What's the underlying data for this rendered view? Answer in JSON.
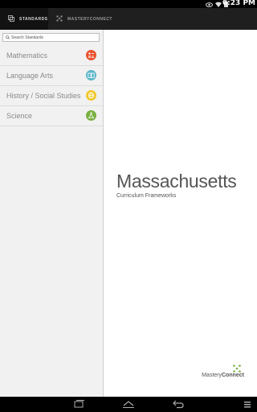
{
  "status": {
    "time": "6:23 PM",
    "icons": [
      "eye-icon",
      "wifi-icon",
      "battery-icon"
    ]
  },
  "tabs": [
    {
      "label": "Standards",
      "icon": "standards-icon",
      "active": true
    },
    {
      "label": "MasteryConnect",
      "icon": "masteryconnect-icon",
      "active": false
    }
  ],
  "search": {
    "placeholder": "Search Standards",
    "value": ""
  },
  "subjects": [
    {
      "label": "Mathematics",
      "icon": "math-icon",
      "color": "#e8532f"
    },
    {
      "label": "Language Arts",
      "icon": "language-arts-icon",
      "color": "#5cb5c9"
    },
    {
      "label": "History / Social Studies",
      "icon": "history-icon",
      "color": "#f2c72a"
    },
    {
      "label": "Science",
      "icon": "science-icon",
      "color": "#7ab043"
    }
  ],
  "main": {
    "title": "Massachusetts",
    "subtitle": "Curriculum Frameworks"
  },
  "brand": {
    "part1": "Mastery",
    "part2": "Connect",
    "logo": "masteryconnect-logo",
    "accent": "#7ab043"
  },
  "nav": [
    "recent-apps-icon",
    "home-icon",
    "back-icon",
    "menu-icon"
  ]
}
